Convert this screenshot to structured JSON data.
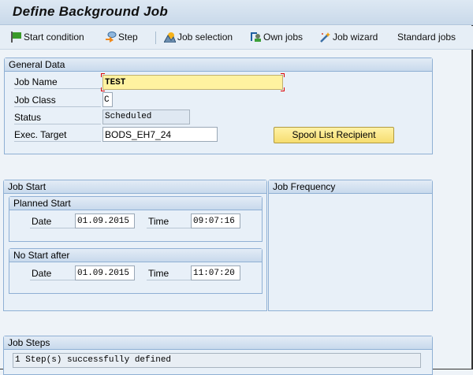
{
  "window": {
    "title": "Define Background Job"
  },
  "toolbar": {
    "items": [
      {
        "label": "Start condition",
        "icon": "flag-icon"
      },
      {
        "label": "Step",
        "icon": "step-icon"
      },
      {
        "label": "Job selection",
        "icon": "mountain-icon"
      },
      {
        "label": "Own jobs",
        "icon": "user-icon"
      },
      {
        "label": "Job wizard",
        "icon": "magic-wand-icon"
      },
      {
        "label": "Standard jobs"
      }
    ]
  },
  "general": {
    "header": "General Data",
    "job_name_label": "Job Name",
    "job_name": "TEST",
    "job_class_label": "Job Class",
    "job_class": "C",
    "status_label": "Status",
    "status": "Scheduled",
    "exec_target_label": "Exec. Target",
    "exec_target": "BODS_EH7_24",
    "spool_button": "Spool List Recipient"
  },
  "job_start": {
    "header": "Job Start",
    "planned": {
      "header": "Planned Start",
      "date_label": "Date",
      "date": "01.09.2015",
      "time_label": "Time",
      "time": "09:07:16"
    },
    "no_start_after": {
      "header": "No Start after",
      "date_label": "Date",
      "date": "01.09.2015",
      "time_label": "Time",
      "time": "11:07:20"
    }
  },
  "job_frequency": {
    "header": "Job Frequency"
  },
  "job_steps": {
    "header": "Job Steps",
    "status": "1 Step(s) successfully defined"
  },
  "colors": {
    "required_field": "#fff2a0",
    "button": "#f6dd70",
    "panel_border": "#8fb0d4"
  }
}
